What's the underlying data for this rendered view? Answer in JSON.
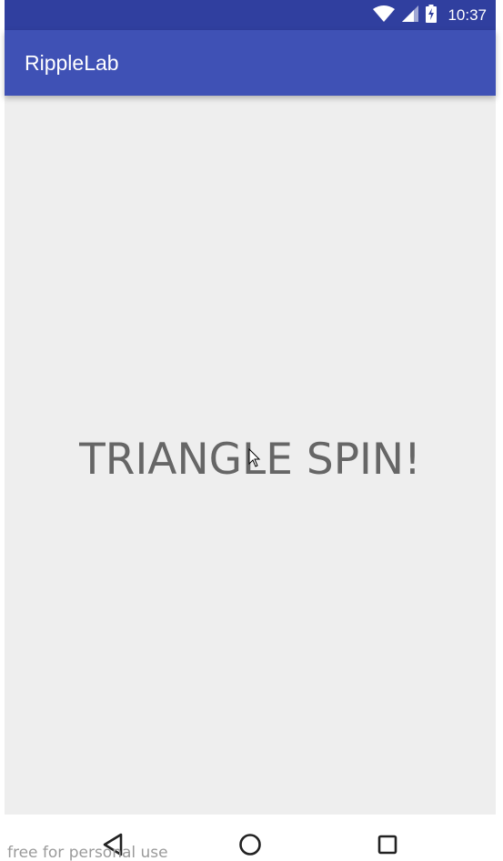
{
  "status_bar": {
    "time": "10:37",
    "icons": [
      "wifi-icon",
      "cell-signal-icon",
      "battery-charging-icon"
    ]
  },
  "app_bar": {
    "title": "RippleLab"
  },
  "main": {
    "text": "TRIANGLE SPIN!"
  },
  "nav_bar": {
    "buttons": [
      "back-triangle-icon",
      "home-circle-icon",
      "recents-square-icon"
    ]
  },
  "watermark": {
    "text": "free for personal use"
  },
  "colors": {
    "status_bar": "#303f9f",
    "app_bar": "#3f51b5",
    "content_bg": "#eeeeee",
    "main_text": "#666666"
  }
}
